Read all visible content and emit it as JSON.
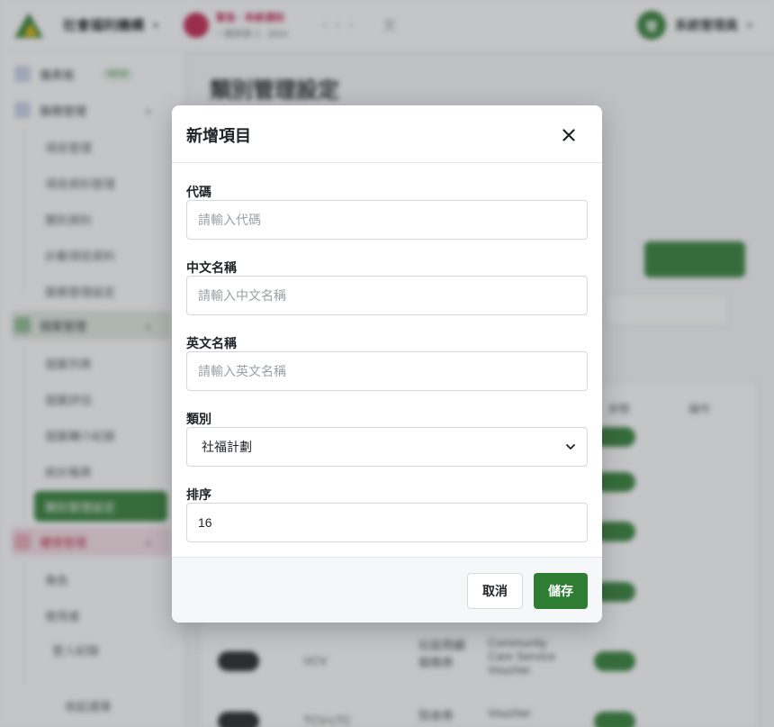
{
  "background": {
    "org_name": "社會福利機構",
    "alert_title": "緊急 · 系統通知",
    "alert_subtitle": "一般訊息 2 · 2024",
    "user_name": "系統管理員",
    "user_initial": "管",
    "page_title": "類別管理設定",
    "sidebar": {
      "dashboard": "儀表板",
      "dashboard_badge": "NEW",
      "group1": "服務管理",
      "group1_items": [
        "項目管理",
        "項目資料管理",
        "類別資料",
        "計劃項目資料",
        "服務管理設定"
      ],
      "group2": "個案管理",
      "group2_items": [
        "個案列表",
        "個案評估",
        "個案轉介紀錄",
        "統計報表"
      ],
      "active_item": "類別管理設定",
      "group3": "權限管理",
      "group3_items": [
        "角色",
        "使用者",
        "登入紀錄"
      ],
      "collapse": "收起選單"
    },
    "table_headers": [
      "狀態",
      "操作"
    ],
    "rows": [
      {
        "code": "VCV",
        "name": "社區照顧服務券",
        "en": "Community Care Service Voucher"
      },
      {
        "code": "TCV-LTC",
        "name": "院舍券",
        "en": "Voucher"
      }
    ]
  },
  "modal": {
    "title": "新增項目",
    "fields": {
      "code": {
        "label": "代碼",
        "placeholder": "請輸入代碼",
        "value": ""
      },
      "name_zh": {
        "label": "中文名稱",
        "placeholder": "請輸入中文名稱",
        "value": ""
      },
      "name_en": {
        "label": "英文名稱",
        "placeholder": "請輸入英文名稱",
        "value": ""
      },
      "category": {
        "label": "類別",
        "selected": "社福計劃"
      },
      "order": {
        "label": "排序",
        "value": "16"
      }
    },
    "buttons": {
      "cancel": "取消",
      "save": "儲存"
    }
  },
  "colors": {
    "primary": "#2e7d32",
    "overlay": "rgba(70,74,82,0.32)"
  },
  "icons": {
    "close": "close-icon",
    "chevron": "chevron-down-icon"
  }
}
